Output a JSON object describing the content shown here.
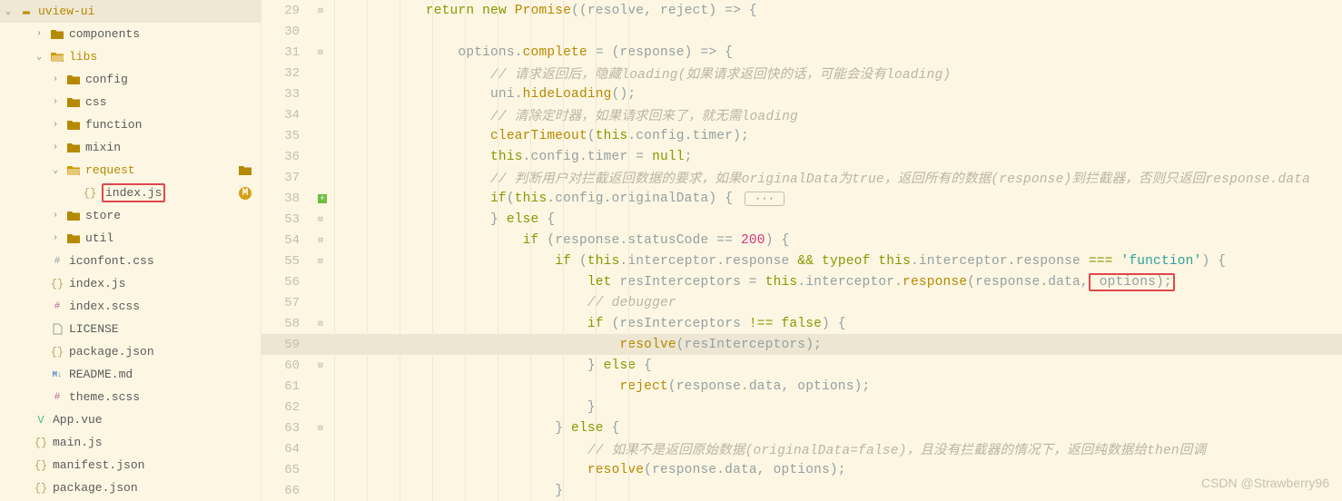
{
  "sidebar": {
    "root": "uview-ui",
    "items": [
      {
        "label": "components",
        "type": "folder",
        "indent": 1,
        "chev": "›"
      },
      {
        "label": "libs",
        "type": "folder-open",
        "indent": 1,
        "chev": "⌄",
        "active": true
      },
      {
        "label": "config",
        "type": "folder",
        "indent": 2,
        "chev": "›"
      },
      {
        "label": "css",
        "type": "folder",
        "indent": 2,
        "chev": "›"
      },
      {
        "label": "function",
        "type": "folder",
        "indent": 2,
        "chev": "›"
      },
      {
        "label": "mixin",
        "type": "folder",
        "indent": 2,
        "chev": "›"
      },
      {
        "label": "request",
        "type": "folder-open",
        "indent": 2,
        "chev": "⌄",
        "active": true,
        "bar": true
      },
      {
        "label": "index.js",
        "type": "file-js",
        "indent": 3,
        "highlighted": true,
        "badge": "M"
      },
      {
        "label": "store",
        "type": "folder",
        "indent": 2,
        "chev": "›"
      },
      {
        "label": "util",
        "type": "folder",
        "indent": 2,
        "chev": "›"
      },
      {
        "label": "iconfont.css",
        "type": "file-css",
        "indent": 1
      },
      {
        "label": "index.js",
        "type": "file-js",
        "indent": 1
      },
      {
        "label": "index.scss",
        "type": "file-scss",
        "indent": 1
      },
      {
        "label": "LICENSE",
        "type": "file",
        "indent": 1
      },
      {
        "label": "package.json",
        "type": "file-json",
        "indent": 1
      },
      {
        "label": "README.md",
        "type": "file-md",
        "indent": 1
      },
      {
        "label": "theme.scss",
        "type": "file-scss",
        "indent": 1
      },
      {
        "label": "App.vue",
        "type": "file-vue",
        "indent": 0
      },
      {
        "label": "main.js",
        "type": "file-js",
        "indent": 0
      },
      {
        "label": "manifest.json",
        "type": "file-json",
        "indent": 0
      },
      {
        "label": "package.json",
        "type": "file-json",
        "indent": 0
      }
    ]
  },
  "code_lines": [
    {
      "num": 29,
      "fold": "⊟",
      "html": "            <span class='kw'>return</span> <span class='kw'>new</span> <span class='fn'>Promise</span>((resolve, reject) => {"
    },
    {
      "num": 30,
      "fold": "",
      "html": ""
    },
    {
      "num": 31,
      "fold": "⊟",
      "html": "                options.<span class='fn'>complete</span> = (response) => {"
    },
    {
      "num": 32,
      "fold": "",
      "html": "                    <span class='cmt'>// 请求返回后，隐藏loading(如果请求返回快的话，可能会没有loading)</span>"
    },
    {
      "num": 33,
      "fold": "",
      "html": "                    uni.<span class='fn'>hideLoading</span>();"
    },
    {
      "num": 34,
      "fold": "",
      "html": "                    <span class='cmt'>// 清除定时器，如果请求回来了，就无需loading</span>"
    },
    {
      "num": 35,
      "fold": "",
      "html": "                    <span class='fn'>clearTimeout</span>(<span class='this'>this</span>.config.timer);"
    },
    {
      "num": 36,
      "fold": "",
      "html": "                    <span class='this'>this</span>.config.timer = <span class='kw'>null</span>;"
    },
    {
      "num": 37,
      "fold": "",
      "html": "                    <span class='cmt'>// 判断用户对拦截返回数据的要求，如果originalData为true，返回所有的数据(response)到拦截器，否则只返回response.data</span>"
    },
    {
      "num": 38,
      "fold": "⊞",
      "plus": true,
      "html": "                    <span class='kw'>if</span>(<span class='this'>this</span>.config.originalData) { <span class='fold-pill'>···</span>"
    },
    {
      "num": 53,
      "fold": "⊟",
      "html": "                    } <span class='kw'>else</span> {"
    },
    {
      "num": 54,
      "fold": "⊟",
      "html": "                        <span class='kw'>if</span> (response.statusCode == <span class='num'>200</span>) {"
    },
    {
      "num": 55,
      "fold": "⊟",
      "html": "                            <span class='kw'>if</span> (<span class='this'>this</span>.interceptor.response <span class='kw'>&&</span> <span class='typeof'>typeof</span> <span class='this'>this</span>.interceptor.response <span class='kw'>===</span> <span class='str'>'function'</span>) {"
    },
    {
      "num": 56,
      "fold": "",
      "html": "                                <span class='let'>let</span> resInterceptors = <span class='this'>this</span>.interceptor.<span class='fn'>response</span>(response.data,<span class='red-box'> options);</span>"
    },
    {
      "num": 57,
      "fold": "",
      "html": "                                <span class='cmt'>// debugger</span>"
    },
    {
      "num": 58,
      "fold": "⊟",
      "html": "                                <span class='kw'>if</span> (resInterceptors <span class='kw'>!==</span> <span class='kw'>false</span>) {"
    },
    {
      "num": 59,
      "fold": "",
      "active": true,
      "html": "                                    <span class='fn'>resolve</span>(resInterceptors);"
    },
    {
      "num": 60,
      "fold": "⊟",
      "html": "                                } <span class='kw'>else</span> {"
    },
    {
      "num": 61,
      "fold": "",
      "html": "                                    <span class='fn'>reject</span>(response.data, options);"
    },
    {
      "num": 62,
      "fold": "",
      "html": "                                }"
    },
    {
      "num": 63,
      "fold": "⊟",
      "html": "                            } <span class='kw'>else</span> {"
    },
    {
      "num": 64,
      "fold": "",
      "html": "                                <span class='cmt'>// 如果不是返回原始数据(originalData=false)，且没有拦截器的情况下，返回纯数据给then回调</span>"
    },
    {
      "num": 65,
      "fold": "",
      "html": "                                <span class='fn'>resolve</span>(response.data, options);"
    },
    {
      "num": 66,
      "fold": "",
      "html": "                            }"
    }
  ],
  "watermark": "CSDN @Strawberry96"
}
